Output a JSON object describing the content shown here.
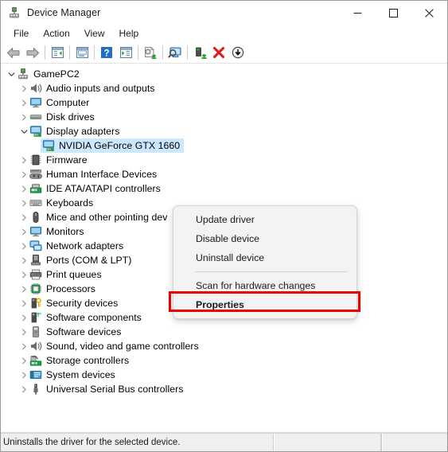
{
  "window": {
    "title": "Device Manager",
    "icon": "device-manager-icon",
    "controls": {
      "minimize": "—",
      "maximize": "□",
      "close": "✕"
    }
  },
  "menubar": {
    "items": [
      {
        "label": "File"
      },
      {
        "label": "Action"
      },
      {
        "label": "View"
      },
      {
        "label": "Help"
      }
    ]
  },
  "toolbar": {
    "buttons": [
      {
        "name": "back-arrow-icon"
      },
      {
        "name": "forward-arrow-icon"
      },
      {
        "name": "separator-1"
      },
      {
        "name": "show-hide-console-tree-icon"
      },
      {
        "name": "separator-2"
      },
      {
        "name": "properties-icon"
      },
      {
        "name": "separator-3"
      },
      {
        "name": "help-icon"
      },
      {
        "name": "show-hide-action-pane-icon"
      },
      {
        "name": "separator-4"
      },
      {
        "name": "update-driver-icon"
      },
      {
        "name": "separator-5"
      },
      {
        "name": "scan-for-hardware-changes-icon"
      },
      {
        "name": "separator-6"
      },
      {
        "name": "enable-device-icon"
      },
      {
        "name": "uninstall-device-icon"
      },
      {
        "name": "disable-device-icon"
      }
    ]
  },
  "tree": {
    "nodes": [
      {
        "label": "GamePC2",
        "depth": 0,
        "state": "expanded",
        "icon": "computer-root-icon",
        "selected": false
      },
      {
        "label": "Audio inputs and outputs",
        "depth": 1,
        "state": "collapsed",
        "icon": "speaker-icon",
        "selected": false
      },
      {
        "label": "Computer",
        "depth": 1,
        "state": "collapsed",
        "icon": "monitor-icon",
        "selected": false
      },
      {
        "label": "Disk drives",
        "depth": 1,
        "state": "collapsed",
        "icon": "disk-drive-icon",
        "selected": false
      },
      {
        "label": "Display adapters",
        "depth": 1,
        "state": "expanded",
        "icon": "display-adapter-icon",
        "selected": false
      },
      {
        "label": "NVIDIA GeForce GTX 1660",
        "depth": 2,
        "state": "leaf",
        "icon": "display-adapter-icon",
        "selected": true
      },
      {
        "label": "Firmware",
        "depth": 1,
        "state": "collapsed",
        "icon": "firmware-chip-icon",
        "selected": false
      },
      {
        "label": "Human Interface Devices",
        "depth": 1,
        "state": "collapsed",
        "icon": "gamepad-icon",
        "selected": false
      },
      {
        "label": "IDE ATA/ATAPI controllers",
        "depth": 1,
        "state": "collapsed",
        "icon": "ide-controller-icon",
        "selected": false
      },
      {
        "label": "Keyboards",
        "depth": 1,
        "state": "collapsed",
        "icon": "keyboard-icon",
        "selected": false
      },
      {
        "label": "Mice and other pointing dev",
        "depth": 1,
        "state": "collapsed",
        "icon": "mouse-icon",
        "selected": false
      },
      {
        "label": "Monitors",
        "depth": 1,
        "state": "collapsed",
        "icon": "monitor-icon",
        "selected": false
      },
      {
        "label": "Network adapters",
        "depth": 1,
        "state": "collapsed",
        "icon": "network-adapter-icon",
        "selected": false
      },
      {
        "label": "Ports (COM & LPT)",
        "depth": 1,
        "state": "collapsed",
        "icon": "port-icon",
        "selected": false
      },
      {
        "label": "Print queues",
        "depth": 1,
        "state": "collapsed",
        "icon": "printer-icon",
        "selected": false
      },
      {
        "label": "Processors",
        "depth": 1,
        "state": "collapsed",
        "icon": "processor-icon",
        "selected": false
      },
      {
        "label": "Security devices",
        "depth": 1,
        "state": "collapsed",
        "icon": "security-key-icon",
        "selected": false
      },
      {
        "label": "Software components",
        "depth": 1,
        "state": "collapsed",
        "icon": "software-component-icon",
        "selected": false
      },
      {
        "label": "Software devices",
        "depth": 1,
        "state": "collapsed",
        "icon": "software-device-icon",
        "selected": false
      },
      {
        "label": "Sound, video and game controllers",
        "depth": 1,
        "state": "collapsed",
        "icon": "speaker-icon",
        "selected": false
      },
      {
        "label": "Storage controllers",
        "depth": 1,
        "state": "collapsed",
        "icon": "storage-controller-icon",
        "selected": false
      },
      {
        "label": "System devices",
        "depth": 1,
        "state": "collapsed",
        "icon": "system-device-icon",
        "selected": false
      },
      {
        "label": "Universal Serial Bus controllers",
        "depth": 1,
        "state": "collapsed",
        "icon": "usb-icon",
        "selected": false
      }
    ]
  },
  "context_menu": {
    "items": [
      {
        "label": "Update driver",
        "bold": false,
        "type": "item"
      },
      {
        "label": "Disable device",
        "bold": false,
        "type": "item"
      },
      {
        "label": "Uninstall device",
        "bold": false,
        "type": "item"
      },
      {
        "label": "",
        "bold": false,
        "type": "separator"
      },
      {
        "label": "Scan for hardware changes",
        "bold": false,
        "type": "item"
      },
      {
        "label": "Properties",
        "bold": true,
        "type": "item"
      }
    ],
    "highlighted_item": "Properties",
    "highlight_color": "#ee0000"
  },
  "statusbar": {
    "panes": [
      {
        "text": "Uninstalls the driver for the selected device."
      },
      {
        "text": ""
      },
      {
        "text": ""
      }
    ]
  },
  "colors": {
    "selection": "#cce8ff",
    "annotation": "#ee0000",
    "menu_bg": "#f3f3f3",
    "status_bg": "#efefef"
  }
}
